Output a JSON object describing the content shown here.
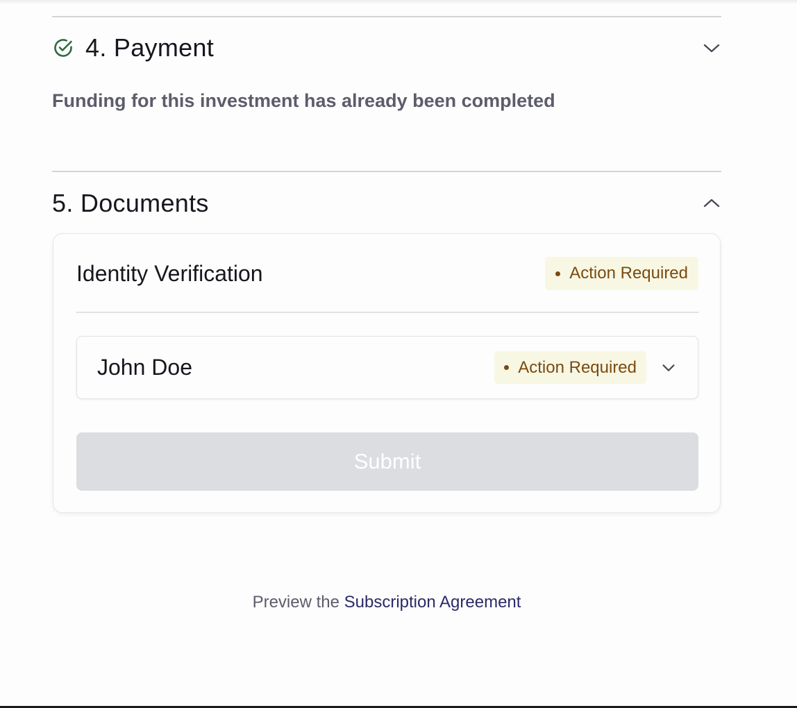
{
  "sections": {
    "payment": {
      "title": "4. Payment",
      "status_icon": "check-circle-icon",
      "status_color": "#2e6b3f",
      "expanded": false,
      "note": "Funding for this investment has already been completed"
    },
    "documents": {
      "title": "5. Documents",
      "expanded": true,
      "card": {
        "title": "Identity Verification",
        "status": "Action Required",
        "signers": [
          {
            "name": "John Doe",
            "status": "Action Required"
          }
        ],
        "submit_label": "Submit"
      }
    }
  },
  "footer": {
    "preview_prefix": "Preview the",
    "preview_link": "Subscription Agreement"
  },
  "colors": {
    "badge_bg": "#f8f7e4",
    "badge_text": "#7a4a10",
    "submit_disabled_bg": "#dcdde1",
    "link": "#2c2a66"
  }
}
